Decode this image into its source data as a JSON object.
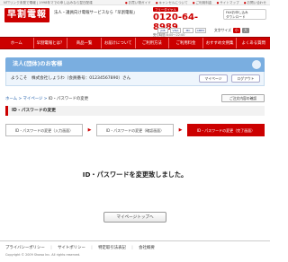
{
  "top_strip": {
    "note": "NTTリンク未発で電報 | 1998年マでの申し込みなら翌日配達",
    "links": [
      "お買い物ガイド",
      "キャンセルについて",
      "ご利用料金",
      "サイトマップ",
      "お問い合わせ"
    ]
  },
  "header": {
    "logo": "早割電報",
    "tagline": "法人・議員向け電報サービスなら「早割電報」",
    "free_label": "フリーダイヤル",
    "phone": "0120-64-8989",
    "hours": "受付時間 8:00〜22:00",
    "fax_label": "FAXお申し込み",
    "fax_sub": "ダウンロード"
  },
  "payment_icons": [
    "JCB",
    "VISA",
    "MC",
    "AMEX"
  ],
  "font_size": {
    "label": "文字サイズ",
    "small": "小",
    "large": "大"
  },
  "nav": {
    "items": [
      "ホーム",
      "早割電報とは？",
      "商品一覧",
      "お届けについて",
      "ご利用方法",
      "ご利用料金",
      "おすすめ文例集",
      "よくある質問"
    ]
  },
  "member": {
    "band_title": "法人(団体)のお客様",
    "welcome": "ようこそ　株式会社しょうわ（会員番号：01234567890）さん",
    "mypage_label": "マイページ",
    "logout_label": "ログアウト"
  },
  "breadcrumb": {
    "home": "ホーム",
    "mypage": "マイページ",
    "current": "ID・パスワードの変更"
  },
  "cart_label": "ご注文内容の確認",
  "section_title": "ID・パスワードの変更",
  "steps": [
    {
      "label": "ID・パスワードの変更（入力画面）"
    },
    {
      "label": "ID・パスワードの変更（確認画面）"
    },
    {
      "label": "ID・パスワードの変更（完了画面）"
    }
  ],
  "message": "ID・パスワードを変更致しました。",
  "mypage_top_button": "マイページトップへ",
  "footer": {
    "links": [
      "プライバシーポリシー",
      "サイトポリシー",
      "特定取引法表記",
      "会社概要"
    ],
    "copyright": "Copyright © 2009 Showa Inc. All rights reserved."
  },
  "colors": {
    "brand_red": "#cc0000",
    "member_blue": "#7aaee0"
  }
}
